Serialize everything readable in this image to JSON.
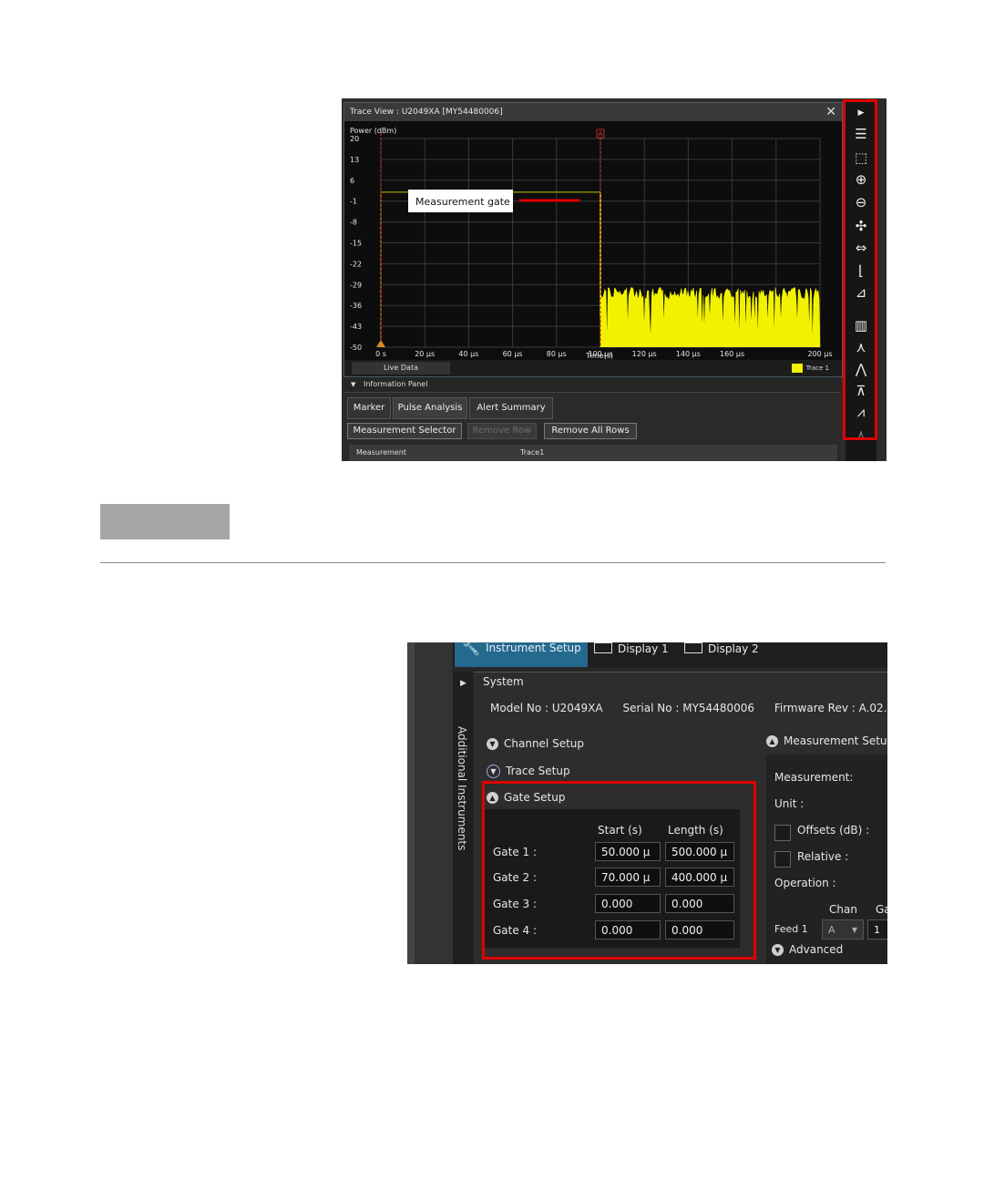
{
  "trace_view": {
    "title": "Trace View : U2049XA [MY54480006]",
    "close_glyph": "✕",
    "marker_label": "A",
    "annotation": "Measurement gate",
    "live_data": "Live Data",
    "legend_trace": "Trace 1",
    "colors": {
      "trace": "#f2f200",
      "gate": "#c8c200",
      "marker": "#e03030",
      "annotation_line": "#e00000"
    }
  },
  "chart_data": {
    "type": "line",
    "title": "",
    "xlabel": "Time(s)",
    "ylabel": "Power (dBm)",
    "y_ticks": [
      "20",
      "13",
      "6",
      "-1",
      "-8",
      "-15",
      "-22",
      "-29",
      "-36",
      "-43",
      "-50"
    ],
    "x_ticks": [
      "0 s",
      "20 µs",
      "40 µs",
      "60 µs",
      "80 µs",
      "100 µs",
      "120 µs",
      "140 µs",
      "160 µs",
      "200 µs"
    ],
    "ylim": [
      -50,
      20
    ],
    "xlim": [
      0,
      200
    ],
    "grid": true,
    "series": [
      {
        "noise_floor_dbm_min": -50,
        "noise_floor_dbm_max": -30,
        "pulse_end_us": 100
      }
    ],
    "gate": {
      "start_us": 0,
      "end_us": 100,
      "level_dbm": 2
    }
  },
  "info_panel": {
    "header": "Information Panel",
    "tabs": [
      "Marker",
      "Pulse Analysis",
      "Alert Summary"
    ],
    "buttons": {
      "selector": "Measurement Selector",
      "remove_row": "Remove Row",
      "remove_all": "Remove All Rows"
    },
    "table_headers": [
      "Measurement",
      "Trace1"
    ]
  },
  "toolbar_icons": [
    "expand-arrow-icon",
    "list-icon",
    "zoom-region-icon",
    "zoom-in-icon",
    "zoom-out-icon",
    "autoscale-icon",
    "fit-horizontal-icon",
    "trace-icon",
    "trace-stat-icon",
    "bar-chart-icon",
    "marker-icon",
    "marker-peak-icon",
    "gate-icon",
    "trace-math-icon",
    "marker-dim-icon"
  ],
  "instrument_setup": {
    "tabs": {
      "instrument": "Instrument Setup",
      "display1": "Display 1",
      "display2": "Display 2"
    },
    "side_label": "Additional Instruments",
    "system_label": "System",
    "model_label": "Model No :",
    "model_value": "U2049XA",
    "serial_label": "Serial No :",
    "serial_value": "MY54480006",
    "firmware_label": "Firmware Rev :",
    "firmware_value": "A.02.",
    "sections": {
      "channel": "Channel Setup",
      "trace": "Trace Setup",
      "gate": "Gate Setup"
    },
    "gate_headers": {
      "start": "Start (s)",
      "length": "Length (s)"
    },
    "gates": [
      {
        "label": "Gate  1 :",
        "start": "50.000 µ",
        "length": "500.000 µ"
      },
      {
        "label": "Gate  2 :",
        "start": "70.000 µ",
        "length": "400.000 µ"
      },
      {
        "label": "Gate  3 :",
        "start": "0.000",
        "length": "0.000"
      },
      {
        "label": "Gate  4 :",
        "start": "0.000",
        "length": "0.000"
      }
    ],
    "measurement": {
      "header": "Measurement Setup",
      "measurement_label": "Measurement:",
      "unit_label": "Unit :",
      "offsets_label": "Offsets (dB) :",
      "relative_label": "Relative :",
      "operation_label": "Operation :",
      "chan_header": "Chan",
      "g_header": "Ga",
      "feed_label": "Feed 1",
      "feed_value": "A",
      "feed_gate": "1",
      "advanced_label": "Advanced"
    }
  }
}
